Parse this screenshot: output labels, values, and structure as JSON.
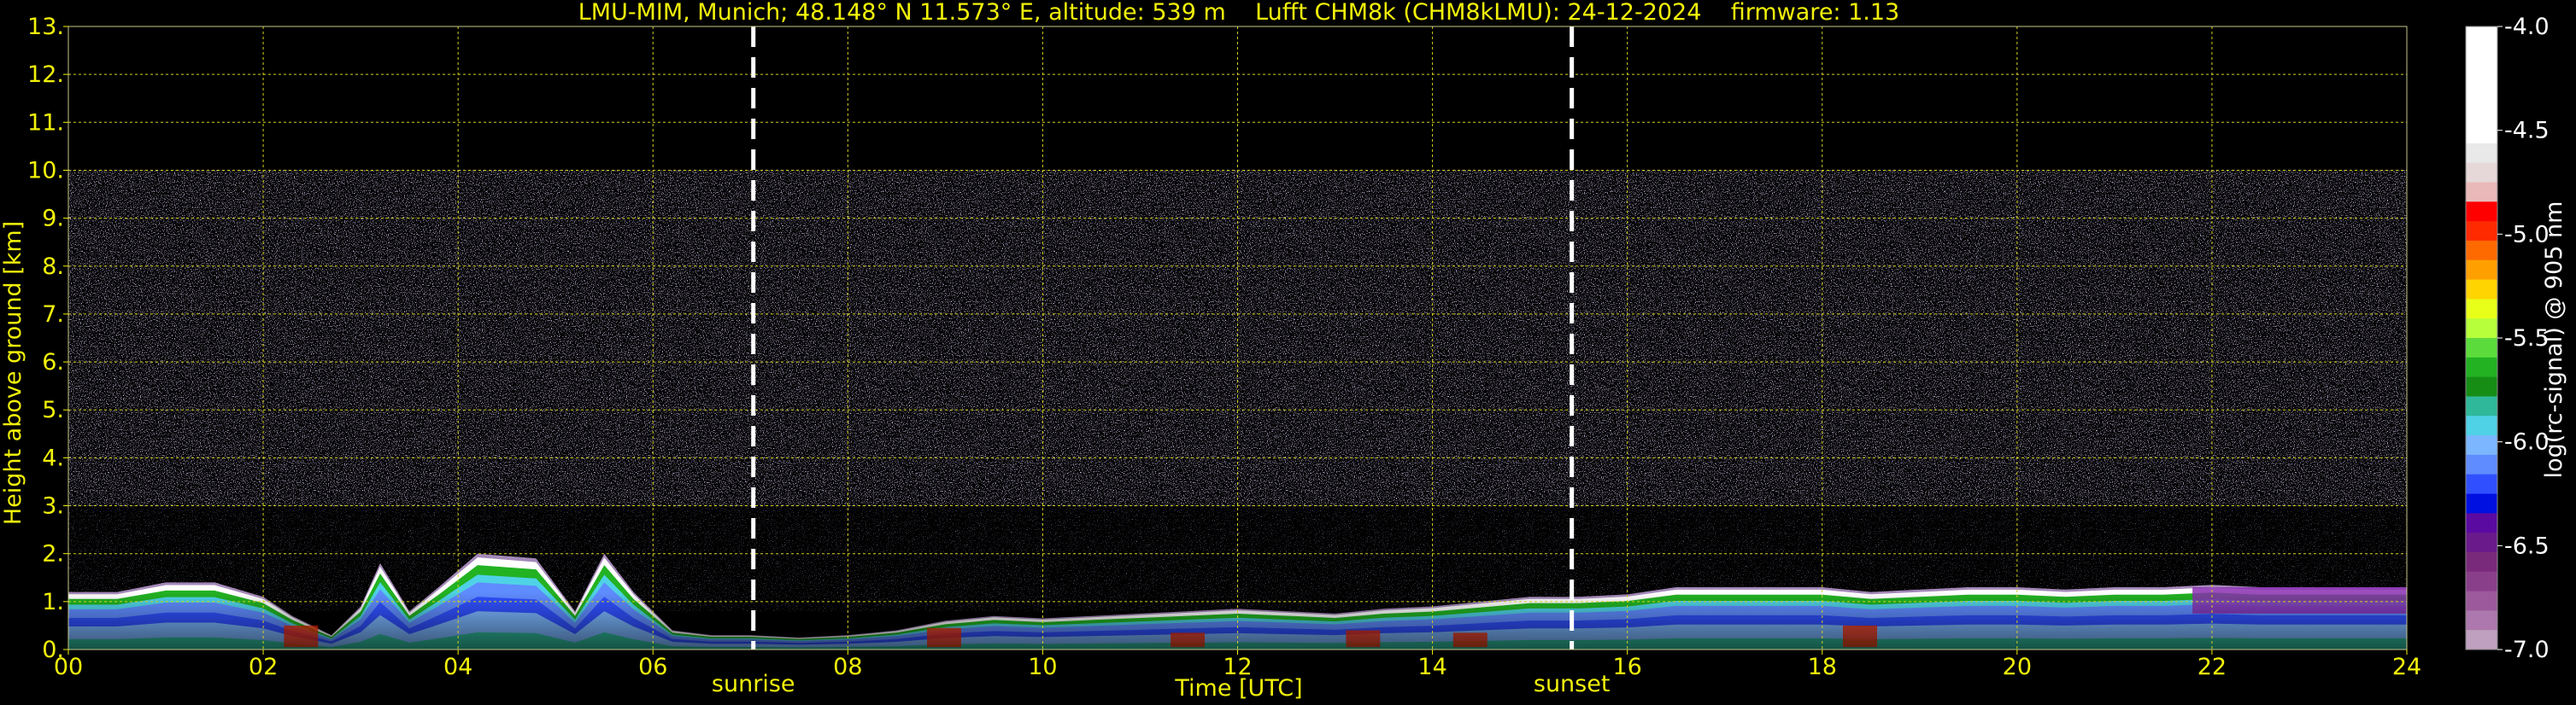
{
  "chart_data": {
    "type": "heatmap",
    "title": "LMU-MIM, Munich; 48.148° N 11.573° E, altitude: 539 m    Lufft CHM8k (CHM8kLMU): 24-12-2024    firmware: 1.13",
    "xlabel": "Time [UTC]",
    "ylabel": "Height above ground [km]",
    "xlim": [
      0,
      24
    ],
    "ylim": [
      0,
      13
    ],
    "x_ticks": [
      "00",
      "02",
      "04",
      "06",
      "08",
      "10",
      "12",
      "14",
      "16",
      "18",
      "20",
      "22",
      "24"
    ],
    "y_ticks": [
      "0.",
      "1.",
      "2.",
      "3.",
      "4.",
      "5.",
      "6.",
      "7.",
      "8.",
      "9.",
      "10.",
      "11.",
      "12.",
      "13."
    ],
    "grid": true,
    "annotations": [
      {
        "label": "sunrise",
        "x": 7.03
      },
      {
        "label": "sunset",
        "x": 15.43
      }
    ],
    "signal_top_km": 10.0,
    "colorbar": {
      "label": "log(rc-signal) @ 905 nm",
      "range": [
        -7.0,
        -4.0
      ],
      "ticks": [
        "-4.0",
        "-4.5",
        "-5.0",
        "-5.5",
        "-6.0",
        "-6.5",
        "-7.0"
      ],
      "colors": [
        "#ffffff",
        "#ffffff",
        "#ffffff",
        "#ffffff",
        "#ffffff",
        "#ffffff",
        "#e9e9e9",
        "#e6d8d8",
        "#e9b9b9",
        "#ff0000",
        "#ff2a00",
        "#ff6a00",
        "#ffa000",
        "#ffd400",
        "#e8ff1a",
        "#b6ff3a",
        "#5cdc3c",
        "#22b222",
        "#168e16",
        "#2fb89a",
        "#4fd2e6",
        "#7bb6ff",
        "#5f8cff",
        "#3050ff",
        "#0010e0",
        "#5a0aa0",
        "#6a1a8a",
        "#7a2a7a",
        "#8a3f8a",
        "#9c5a9c",
        "#ad78ad",
        "#bfa0bf"
      ]
    },
    "cloud_top_km": [
      [
        0.0,
        1.2
      ],
      [
        0.5,
        1.2
      ],
      [
        1.0,
        1.4
      ],
      [
        1.5,
        1.4
      ],
      [
        2.0,
        1.1
      ],
      [
        2.3,
        0.7
      ],
      [
        2.7,
        0.3
      ],
      [
        3.0,
        0.9
      ],
      [
        3.2,
        1.8
      ],
      [
        3.5,
        0.8
      ],
      [
        3.8,
        1.3
      ],
      [
        4.2,
        2.0
      ],
      [
        4.8,
        1.9
      ],
      [
        5.2,
        0.8
      ],
      [
        5.5,
        2.0
      ],
      [
        5.8,
        1.2
      ],
      [
        6.2,
        0.4
      ],
      [
        6.6,
        0.3
      ],
      [
        7.0,
        0.3
      ],
      [
        7.5,
        0.25
      ],
      [
        8.0,
        0.3
      ],
      [
        8.5,
        0.4
      ],
      [
        9.0,
        0.6
      ],
      [
        9.5,
        0.7
      ],
      [
        10.0,
        0.65
      ],
      [
        10.5,
        0.7
      ],
      [
        11.0,
        0.75
      ],
      [
        11.5,
        0.8
      ],
      [
        12.0,
        0.85
      ],
      [
        12.5,
        0.8
      ],
      [
        13.0,
        0.75
      ],
      [
        13.5,
        0.85
      ],
      [
        14.0,
        0.9
      ],
      [
        14.5,
        1.0
      ],
      [
        15.0,
        1.1
      ],
      [
        15.5,
        1.1
      ],
      [
        16.0,
        1.15
      ],
      [
        16.5,
        1.3
      ],
      [
        17.0,
        1.3
      ],
      [
        17.5,
        1.3
      ],
      [
        18.0,
        1.3
      ],
      [
        18.5,
        1.2
      ],
      [
        19.0,
        1.25
      ],
      [
        19.5,
        1.3
      ],
      [
        20.0,
        1.3
      ],
      [
        20.5,
        1.25
      ],
      [
        21.0,
        1.3
      ],
      [
        21.5,
        1.3
      ],
      [
        22.0,
        1.35
      ],
      [
        22.5,
        1.3
      ],
      [
        23.0,
        1.3
      ],
      [
        23.5,
        1.3
      ],
      [
        24.0,
        1.3
      ]
    ]
  }
}
